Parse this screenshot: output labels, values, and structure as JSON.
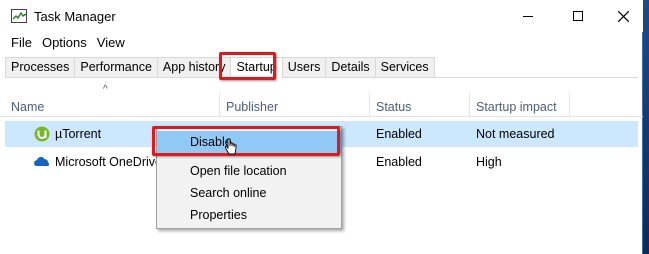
{
  "window": {
    "title": "Task Manager",
    "icon": "task-manager-icon"
  },
  "menu": [
    "File",
    "Options",
    "View"
  ],
  "tabs": [
    "Processes",
    "Performance",
    "App history",
    "Startup",
    "Users",
    "Details",
    "Services"
  ],
  "active_tab": "Startup",
  "columns": {
    "name": "Name",
    "publisher": "Publisher",
    "status": "Status",
    "impact": "Startup impact"
  },
  "rows": [
    {
      "name": "µTorrent",
      "status": "Enabled",
      "impact": "Not measured",
      "icon": "utorrent-icon",
      "selected": true
    },
    {
      "name": "Microsoft OneDrive",
      "status": "Enabled",
      "impact": "High",
      "icon": "onedrive-icon",
      "selected": false
    }
  ],
  "context_menu": [
    "Disable",
    "Open file location",
    "Search online",
    "Properties"
  ],
  "colors": {
    "selection": "#cce8ff",
    "menu_hover": "#90c8f6",
    "highlight_outline": "#e0191f"
  }
}
